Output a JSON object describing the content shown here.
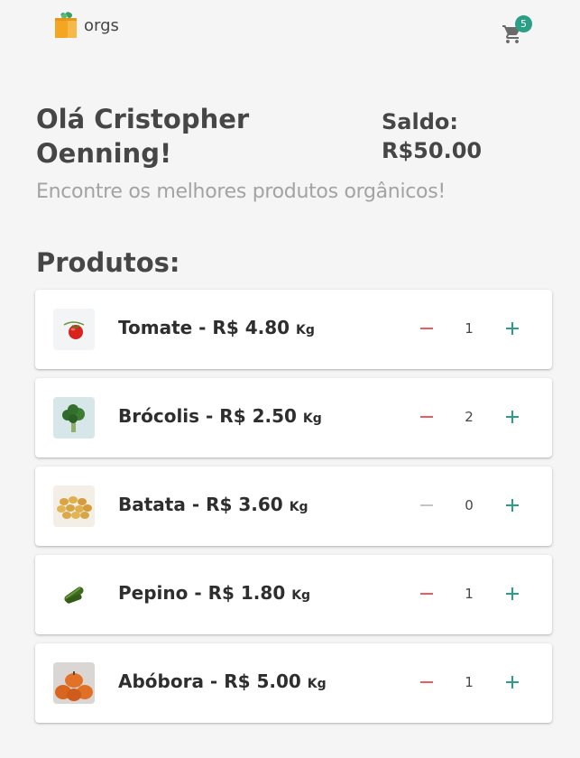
{
  "header": {
    "logo_text": "orgs",
    "cart_count": "5"
  },
  "greeting": "Olá Cristopher Oenning!",
  "saldo_label": "Saldo:",
  "saldo_value": "R$50.00",
  "subtitle": "Encontre os melhores produtos orgânicos!",
  "products_title": "Produtos:",
  "products": [
    {
      "name": "Tomate",
      "price": "R$ 4.80",
      "unit": "Kg",
      "qty": "1",
      "minus_enabled": true
    },
    {
      "name": "Brócolis",
      "price": "R$ 2.50",
      "unit": "Kg",
      "qty": "2",
      "minus_enabled": true
    },
    {
      "name": "Batata",
      "price": "R$ 3.60",
      "unit": "Kg",
      "qty": "0",
      "minus_enabled": false
    },
    {
      "name": "Pepino",
      "price": "R$ 1.80",
      "unit": "Kg",
      "qty": "1",
      "minus_enabled": true
    },
    {
      "name": "Abóbora",
      "price": "R$ 5.00",
      "unit": "Kg",
      "qty": "1",
      "minus_enabled": true
    }
  ],
  "colors": {
    "accent": "#2a9f85",
    "minus_active": "#ec5b62",
    "minus_disabled": "#b0b0b0",
    "text": "#464646",
    "subtitle": "#a3a3a3"
  },
  "icons": {
    "logo": "grocery-bag-icon",
    "cart": "shopping-cart-icon",
    "minus": "minus-icon",
    "plus": "plus-icon"
  }
}
